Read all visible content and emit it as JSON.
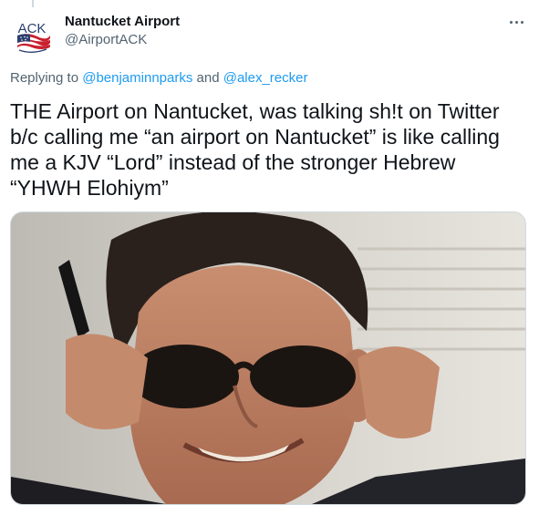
{
  "tweet": {
    "author": {
      "display_name": "Nantucket Airport",
      "handle": "@AirportACK",
      "avatar": {
        "logo_text": "ACK",
        "icon": "flag-logo"
      }
    },
    "reply": {
      "prefix": "Replying to",
      "mention_1": "@benjaminnparks",
      "conjunction": "and",
      "mention_2": "@alex_recker"
    },
    "text": "THE Airport on Nantucket, was talking sh!t on Twitter b/c calling me “an airport on Nantucket” is like calling me a KJV “Lord” instead of the stronger Hebrew “YHWH Elohiym”",
    "media": {
      "type": "gif",
      "icon": "photo-media"
    },
    "more_icon": "more-options-icon"
  },
  "colors": {
    "accent": "#1d9bf0",
    "secondary_text": "#536471",
    "primary_text": "#0f1419",
    "border": "#cfd9de"
  }
}
